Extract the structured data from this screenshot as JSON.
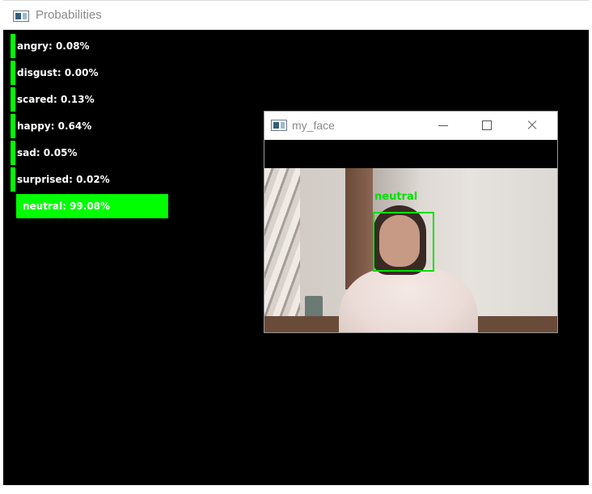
{
  "probabilities_window": {
    "title": "Probabilities",
    "bars": [
      {
        "emotion": "angry",
        "label": "angry: 0.08%",
        "percent": 0.08
      },
      {
        "emotion": "disgust",
        "label": "disgust: 0.00%",
        "percent": 0.0
      },
      {
        "emotion": "scared",
        "label": "scared: 0.13%",
        "percent": 0.13
      },
      {
        "emotion": "happy",
        "label": "happy: 0.64%",
        "percent": 0.64
      },
      {
        "emotion": "sad",
        "label": "sad: 0.05%",
        "percent": 0.05
      },
      {
        "emotion": "surprised",
        "label": "surprised: 0.02%",
        "percent": 0.02
      },
      {
        "emotion": "neutral",
        "label": "neutral: 99.08%",
        "percent": 99.08
      }
    ],
    "bar_color": "#00ff00",
    "background_color": "#000000"
  },
  "face_window": {
    "title": "my_face",
    "detection_label": "neutral",
    "box_color": "#00e000",
    "controls": [
      "minimize-icon",
      "maximize-icon",
      "close-icon"
    ]
  }
}
